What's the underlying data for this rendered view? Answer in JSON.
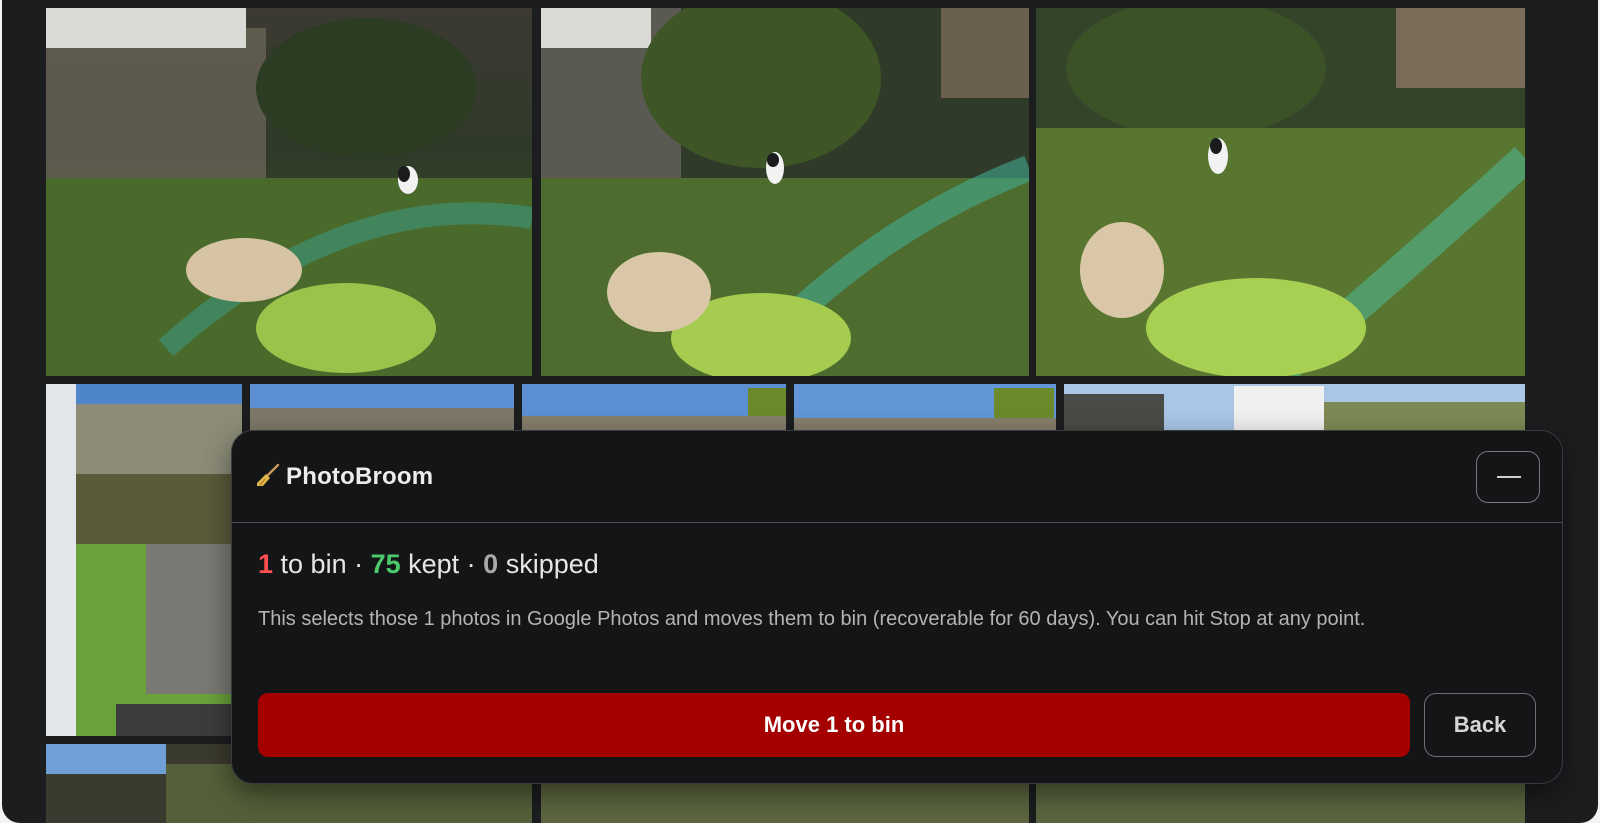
{
  "widget": {
    "title": "PhotoBroom",
    "icon": "broom-icon",
    "minimize_icon": "minus-icon"
  },
  "summary": {
    "bin_count": "1",
    "bin_label": " to bin · ",
    "kept_count": "75",
    "kept_label": " kept · ",
    "skipped_count": "0",
    "skipped_label": " skipped"
  },
  "description": "This selects those 1 photos in Google Photos and moves them to bin (recoverable for 60 days). You can hit Stop at any point.",
  "actions": {
    "primary_label": "Move 1 to bin",
    "back_label": "Back"
  },
  "colors": {
    "bin": "#ff4f4f",
    "kept": "#4cc96a",
    "skipped": "#a9a9a9",
    "primary_button": "#a40000"
  }
}
